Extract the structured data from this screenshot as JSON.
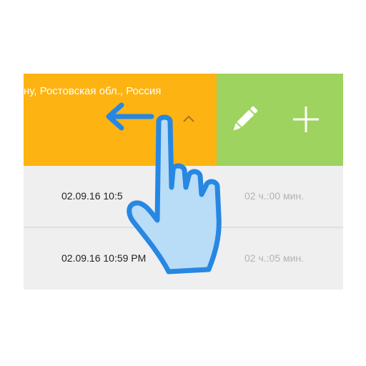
{
  "item": {
    "address": "ну, Ростовская обл., Россия",
    "actions": {
      "edit_icon": "pencil-icon",
      "add_icon": "plus-icon"
    }
  },
  "list": {
    "rows": [
      {
        "time": "02.09.16 10:5",
        "duration": "02 ч.:00 мин."
      },
      {
        "time": "02.09.16 10:59 PM",
        "duration": "02 ч.:05 мин."
      }
    ]
  },
  "gesture": {
    "type": "swipe-left",
    "icon": "hand-pointer-icon",
    "arrow_icon": "arrow-left-icon"
  },
  "colors": {
    "orange": "#fdb312",
    "green": "#9dd35e",
    "row_bg": "#efefef",
    "hand_fill": "#b9dcf7",
    "hand_stroke": "#2787e3"
  }
}
